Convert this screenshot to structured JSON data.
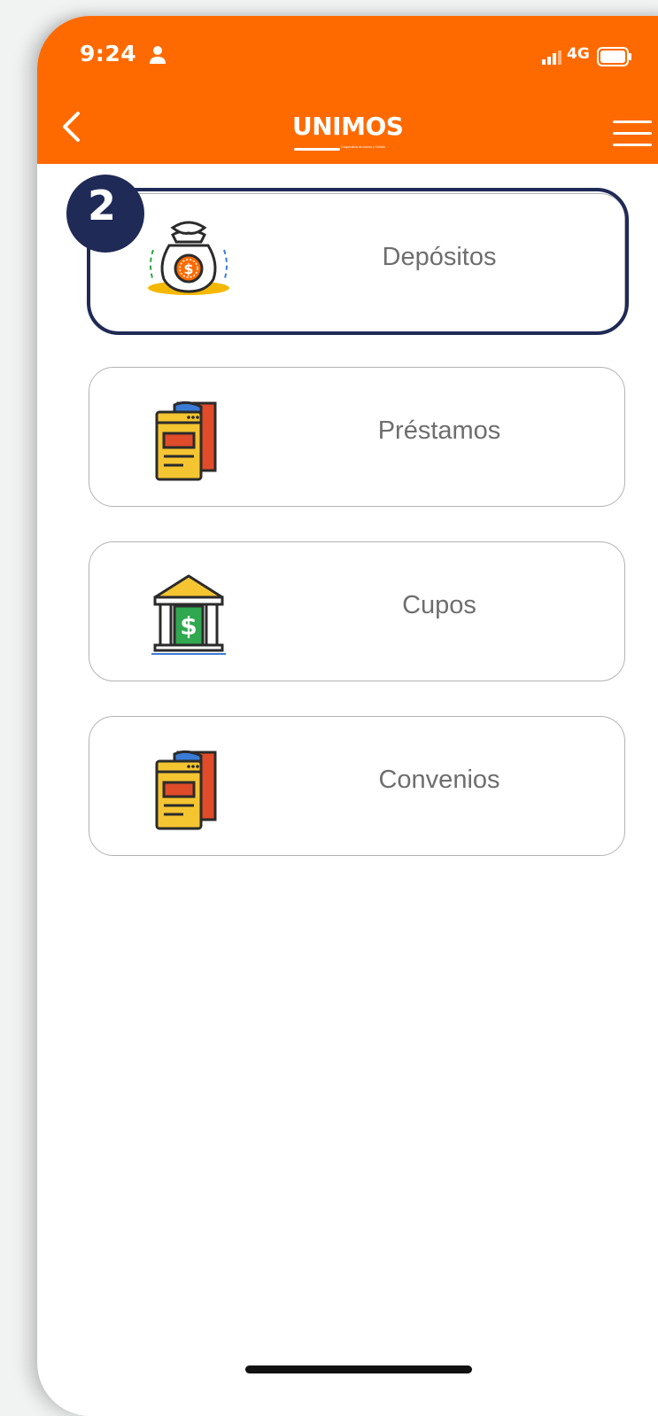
{
  "status_bar": {
    "time": "9:24",
    "network": "4G"
  },
  "header": {
    "logo_text": "UNIMOS",
    "logo_subtitle": "Cooperativa de Ahorro y Crédito",
    "back_icon": "chevron-left-icon",
    "menu_icon": "hamburger-menu-icon"
  },
  "step_badge": "2",
  "menu_items": [
    {
      "label": "Depósitos",
      "icon": "money-bag-icon",
      "highlighted": true
    },
    {
      "label": "Préstamos",
      "icon": "document-book-icon",
      "highlighted": false
    },
    {
      "label": "Cupos",
      "icon": "bank-dollar-icon",
      "highlighted": false
    },
    {
      "label": "Convenios",
      "icon": "document-book-icon",
      "highlighted": false
    }
  ],
  "colors": {
    "header": "#ff6a00",
    "highlight": "#1f2a56",
    "label": "#6e6e6e"
  }
}
